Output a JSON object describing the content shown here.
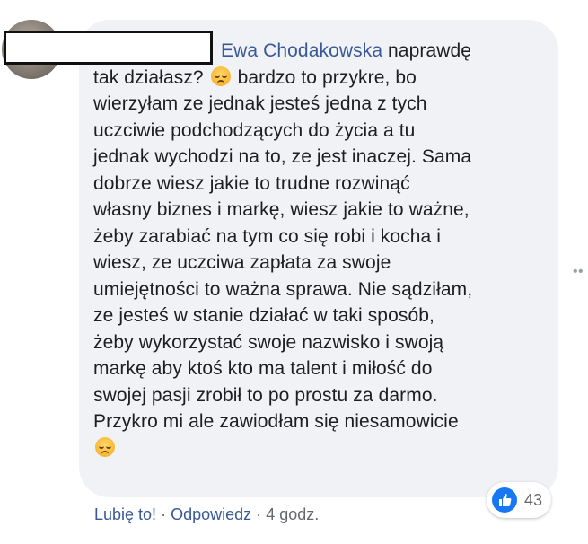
{
  "comment": {
    "author": "Ewa Chodakowska",
    "lines": [
      "naprawdę",
      "tak działasz?",
      "bardzo to przykre, bo",
      "wierzyłam ze jednak jesteś jedna z tych",
      "uczciwie podchodzących do życia a tu",
      "jednak wychodzi na to, ze jest inaczej. Sama",
      "dobrze wiesz jakie to trudne rozwinąć",
      "własny biznes i markę, wiesz jakie to ważne,",
      "żeby zarabiać na tym co się robi i kocha i",
      "wiesz, ze uczciwa zapłata za swoje",
      "umiejętności to ważna sprawa. Nie sądziłam,",
      "ze jesteś w stanie działać w taki sposób,",
      "żeby wykorzystać swoje nazwisko i swoją",
      "markę aby ktoś kto ma talent i miłość do",
      "swojej pasji zrobił to po prostu za darmo.",
      "Przykro mi ale zawiodłam się niesamowicie"
    ],
    "emoji": "pensive-face-icon"
  },
  "reactions": {
    "icon": "like-thumb-icon",
    "count": "43"
  },
  "actions": {
    "like": "Lubię to!",
    "separator": "·",
    "reply": "Odpowiedz",
    "time": "4 godz."
  },
  "colors": {
    "bubble": "#f0f2f5",
    "link": "#385898",
    "like_blue": "#1877f2"
  }
}
